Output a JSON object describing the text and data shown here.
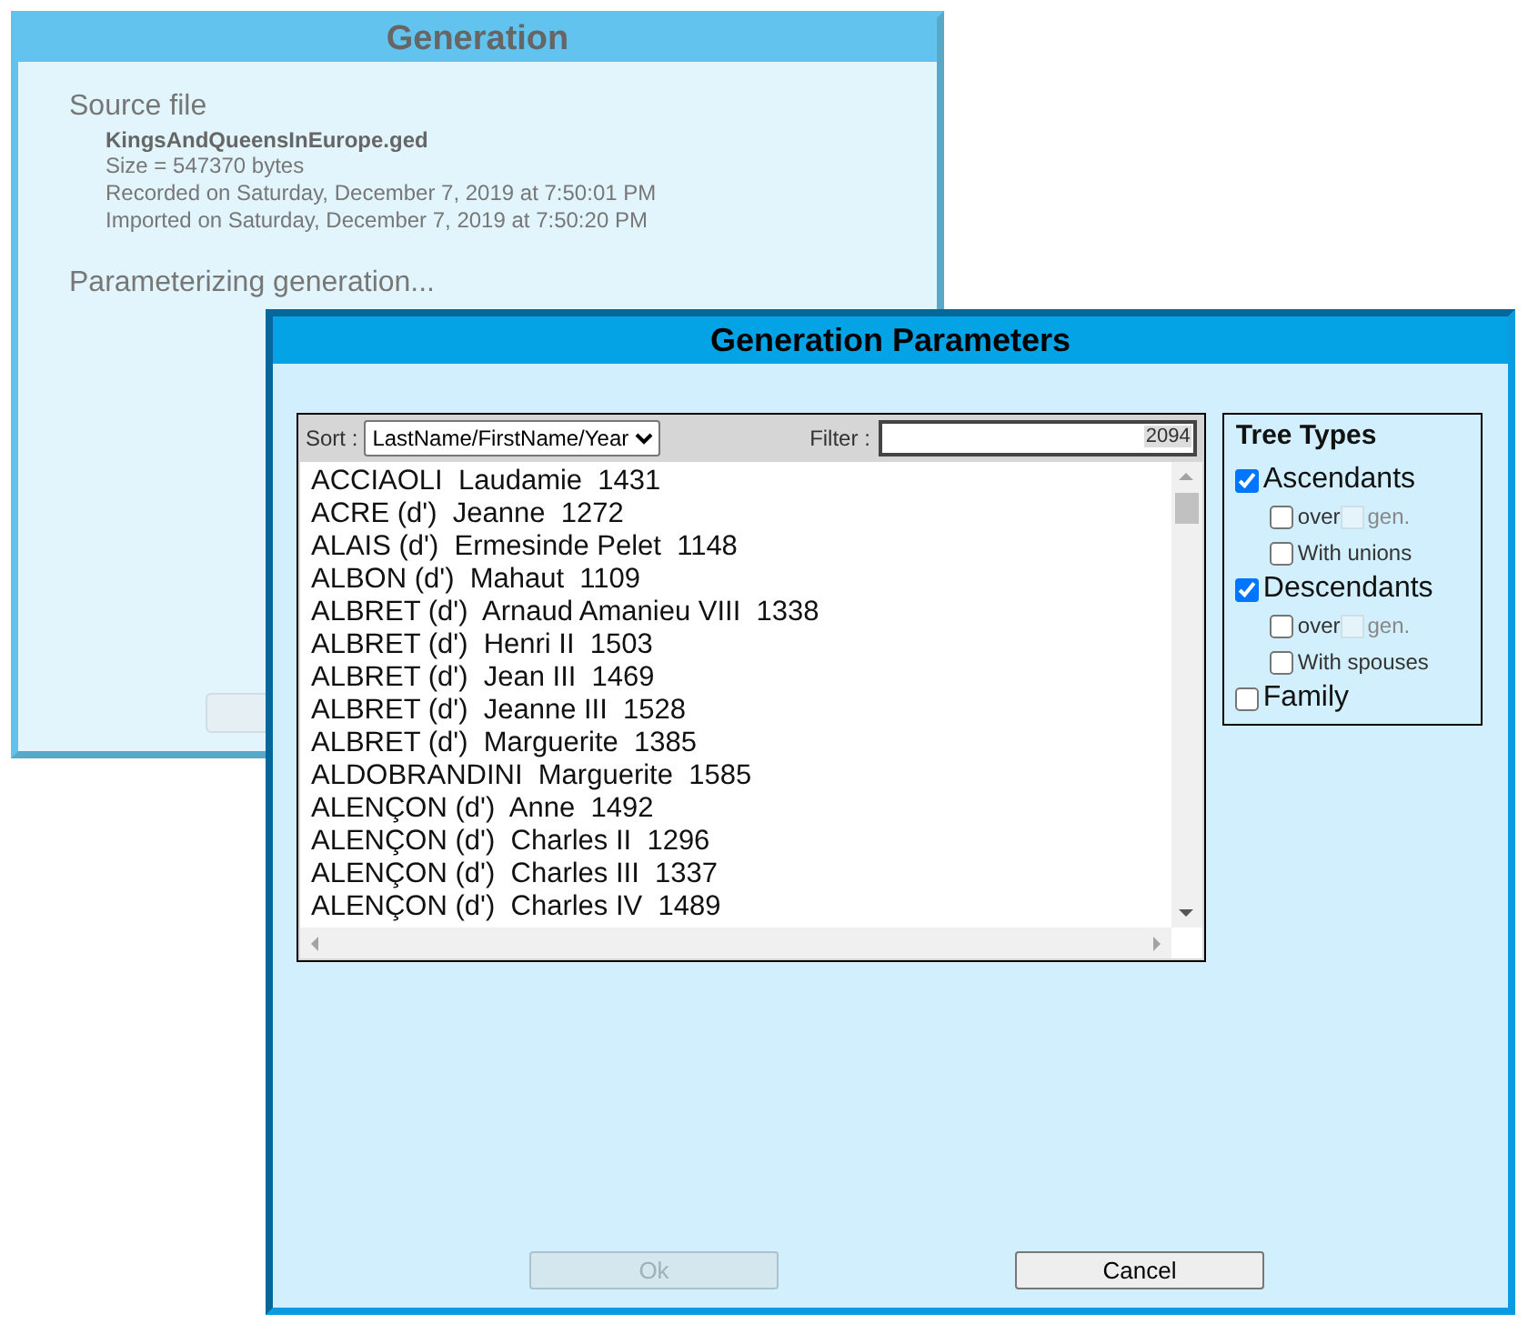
{
  "background_window": {
    "title": "Generation",
    "source_heading": "Source file",
    "file_name": "KingsAndQueensInEurope.ged",
    "details": [
      "Size = 547370 bytes",
      "Recorded on Saturday, December 7, 2019 at 7:50:01 PM",
      "Imported on Saturday, December 7, 2019 at 7:50:20 PM"
    ],
    "status": "Parameterizing generation..."
  },
  "dialog": {
    "title": "Generation Parameters",
    "sort": {
      "label": "Sort :",
      "value": "LastName/FirstName/Year"
    },
    "filter": {
      "label": "Filter :",
      "count": "2094"
    },
    "persons": [
      {
        "name": "ACCIAOLI  Laudamie  1431"
      },
      {
        "name": "ACRE (d')  Jeanne  1272"
      },
      {
        "name": "ALAIS (d')  Ermesinde Pelet  1148"
      },
      {
        "name": "ALBON (d')  Mahaut  1109"
      },
      {
        "name": "ALBRET (d')  Arnaud Amanieu VIII  1338"
      },
      {
        "name": "ALBRET (d')  Henri II  1503"
      },
      {
        "name": "ALBRET (d')  Jean III  1469"
      },
      {
        "name": "ALBRET (d')  Jeanne III  1528"
      },
      {
        "name": "ALBRET (d')  Marguerite  1385"
      },
      {
        "name": "ALDOBRANDINI  Marguerite  1585"
      },
      {
        "name": "ALENÇON (d')  Anne  1492"
      },
      {
        "name": "ALENÇON (d')  Charles II  1296"
      },
      {
        "name": "ALENÇON (d')  Charles III  1337"
      },
      {
        "name": "ALENÇON (d')  Charles IV  1489"
      }
    ],
    "tree_types": {
      "title": "Tree Types",
      "options": [
        {
          "kind": "main",
          "label": "Ascendants",
          "checked": true
        },
        {
          "kind": "over",
          "label": "over",
          "unit": "gen.",
          "checked": false
        },
        {
          "kind": "sub",
          "label": "With unions",
          "checked": false
        },
        {
          "kind": "main",
          "label": "Descendants",
          "checked": true
        },
        {
          "kind": "over",
          "label": "over",
          "unit": "gen.",
          "checked": false
        },
        {
          "kind": "sub",
          "label": "With spouses",
          "checked": false
        },
        {
          "kind": "main",
          "label": "Family",
          "checked": false
        }
      ]
    },
    "buttons": [
      {
        "label": "Ok",
        "disabled": true
      },
      {
        "label": "Cancel",
        "disabled": false
      }
    ]
  }
}
